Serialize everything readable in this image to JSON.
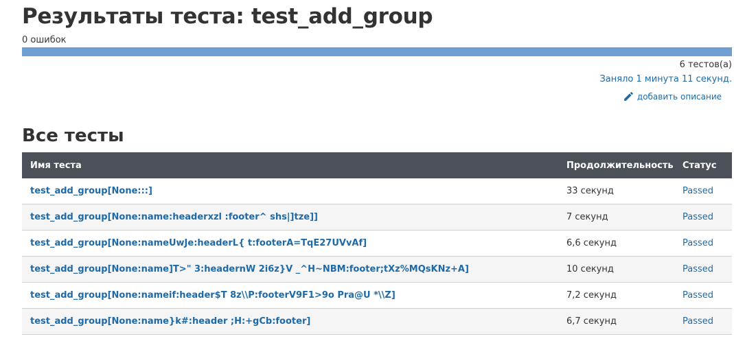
{
  "header": {
    "title": "Результаты теста: test_add_group",
    "errors": "0 ошибок",
    "progress_passed_fraction": 1.0,
    "tests_count": "6 тестов(а)",
    "duration": "Заняло 1 минута 11 секунд.",
    "add_description": "добавить описание"
  },
  "section": {
    "title": "Все тесты"
  },
  "table": {
    "columns": [
      "Имя теста",
      "Продолжительность",
      "Статус"
    ],
    "rows": [
      {
        "name": "test_add_group[None:::]",
        "duration": "33 секунд",
        "status": "Passed"
      },
      {
        "name": "test_add_group[None:name:headerxzl :footer^ shs|]tze]]",
        "duration": "7 секунд",
        "status": "Passed"
      },
      {
        "name": "test_add_group[None:nameUwJe:headerL{ t:footerA=TqE27UVvAf]",
        "duration": "6,6 секунд",
        "status": "Passed"
      },
      {
        "name": "test_add_group[None:name]T>\" 3:headernW 2i6z}V _^H~NBM:footer;tXz%MQsKNz+A]",
        "duration": "10 секунд",
        "status": "Passed"
      },
      {
        "name": "test_add_group[None:nameif:header$T 8z\\\\P:footerV9F1>9o Pra@U *\\\\Z]",
        "duration": "7,2 секунд",
        "status": "Passed"
      },
      {
        "name": "test_add_group[None:name}k#:header ;H:+gCb:footer]",
        "duration": "6,7 секунд",
        "status": "Passed"
      }
    ]
  },
  "colors": {
    "progress": "#6f9fd1",
    "link": "#1e6aa8",
    "table_header": "#4b5059"
  },
  "icons": {
    "edit": "pencil-icon"
  }
}
